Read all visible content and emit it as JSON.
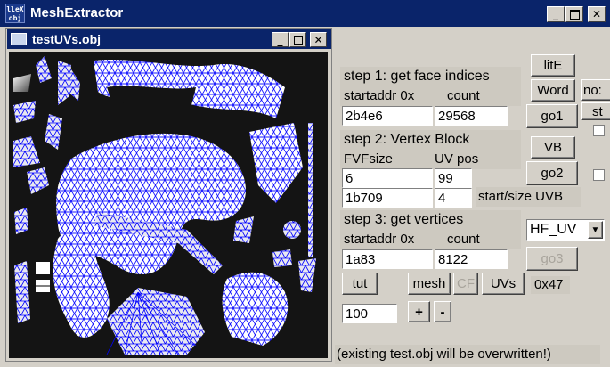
{
  "window": {
    "title": "MeshExtractor",
    "icon_text": "lleX obj"
  },
  "child": {
    "title": "testUVs.obj"
  },
  "step1": {
    "heading": "step 1: get face indices",
    "addr_label": "startaddr 0x",
    "count_label": "count",
    "addr_value": "2b4e6",
    "count_value": "29568"
  },
  "step2": {
    "heading": "step 2: Vertex Block",
    "fvf_label": "FVFsize",
    "uv_label": "UV pos",
    "fvf_value": "6",
    "uv_value": "99",
    "start_value": "1b709",
    "size_value": "4",
    "start_size_label": "start/size UVB"
  },
  "step3": {
    "heading": "step 3: get vertices",
    "addr_label": "startaddr 0x",
    "count_label": "count",
    "addr_value": "1a83",
    "count_value": "8122"
  },
  "buttons": {
    "lite": "litE",
    "word": "Word",
    "go1": "go1",
    "vb": "VB",
    "go2": "go2",
    "go3": "go3",
    "tut": "tut",
    "mesh": "mesh",
    "cf": "CF",
    "uvs": "UVs",
    "plus": "+",
    "minus": "-"
  },
  "select": {
    "value": "HF_UV"
  },
  "hex_label": "0x47",
  "zoom_value": "100",
  "partial": {
    "no_label": "no:",
    "st_label": "st"
  },
  "status": "(existing test.obj will be overwritten!)"
}
